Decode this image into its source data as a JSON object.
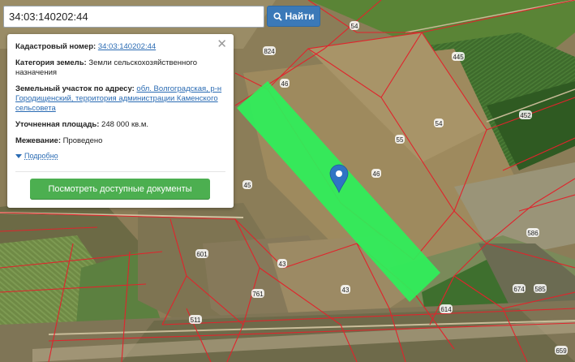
{
  "search": {
    "query": "34:03:140202:44",
    "button_label": "Найти"
  },
  "info_panel": {
    "cadastral_label": "Кадастровый номер:",
    "cadastral_value": "34:03:140202:44",
    "category_label": "Категория земель:",
    "category_value": "Земли сельскохозяйственного назначения",
    "address_label": "Земельный участок по адресу:",
    "address_value": "обл. Волгоградская, р-н Городищенский, территория администрации Каменского сельсовета",
    "area_label": "Уточненная площадь:",
    "area_value": "248 000 кв.м.",
    "survey_label": "Межевание:",
    "survey_value": "Проведено",
    "more_label": "Подробно",
    "docs_button": "Посмотреть доступные документы",
    "close_icon": "close-icon"
  },
  "map": {
    "parcel_numbers": [
      "824",
      "54",
      "445",
      "452",
      "46",
      "54",
      "55",
      "46",
      "45",
      "586",
      "601",
      "43",
      "761",
      "43",
      "614",
      "674",
      "585",
      "511",
      "659"
    ],
    "selected_parcel_color": "#2ef05a",
    "boundary_color": "#e0242c",
    "marker_icon": "map-pin-icon"
  }
}
